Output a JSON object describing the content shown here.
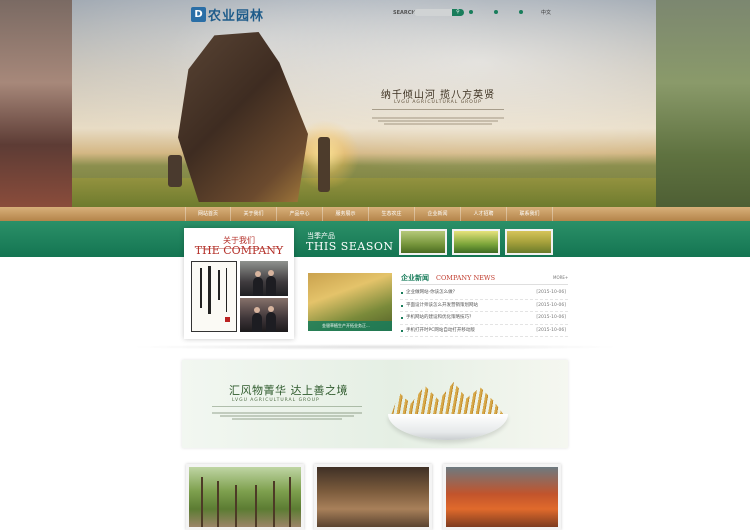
{
  "header": {
    "logo_text": "农业园林",
    "logo_mark": "D",
    "search_label": "SEARCH",
    "search_placeholder": "",
    "search_button": "",
    "top_links": [
      "",
      ""
    ],
    "lang": "中文"
  },
  "hero": {
    "slogan": "纳千倾山河 揽八方英贤",
    "slogan_en": "LVGU AGRICULTURAL GROUP"
  },
  "nav": {
    "items": [
      "网站首页",
      "关于我们",
      "产品中心",
      "服务展示",
      "生态农庄",
      "企业新闻",
      "人才招聘",
      "联系我们"
    ]
  },
  "season": {
    "cn": "当季产品",
    "en": "THIS SEASON"
  },
  "about": {
    "cn": "关于我们",
    "en": "THE COMPANY"
  },
  "news": {
    "image_caption": "金银草植生产开拓业务正...",
    "title_cn": "企业新闻",
    "title_en": "COMPANY NEWS",
    "more": "MORE+",
    "items": [
      {
        "title": "企业做网站-你该怎么做？",
        "date": "[2015-10-06]"
      },
      {
        "title": "平面设计师该怎么开发营销策划网站",
        "date": "[2015-10-06]"
      },
      {
        "title": "手机网站的建设和优化策略技巧？",
        "date": "[2015-10-06]"
      },
      {
        "title": "手机打开时PC网站自动打开移动版",
        "date": "[2015-10-06]"
      }
    ]
  },
  "banner": {
    "cn": "汇风物菁华 达上善之境",
    "en": "LVGU AGRICULTURAL GROUP"
  },
  "colors": {
    "brand_green": "#197d5b",
    "accent_red": "#b5322b",
    "nav_tan": "#c89a5f",
    "logo_blue": "#2a6ea6"
  }
}
